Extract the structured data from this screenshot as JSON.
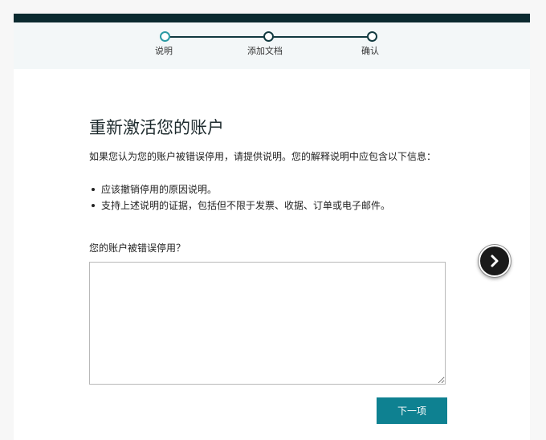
{
  "stepper": {
    "steps": [
      {
        "label": "说明",
        "state": "current"
      },
      {
        "label": "添加文档",
        "state": "pending"
      },
      {
        "label": "确认",
        "state": "pending"
      }
    ]
  },
  "main": {
    "title": "重新激活您的账户",
    "description": "如果您认为您的账户被错误停用，请提供说明。您的解释说明中应包含以下信息：",
    "bullets": [
      "应该撤销停用的原因说明。",
      "支持上述说明的证据，包括但不限于发票、收据、订单或电子邮件。"
    ],
    "field_label": "您的账户被错误停用？",
    "textarea_value": "",
    "next_label": "下一项"
  },
  "overlay": {
    "icon": "chevron-right-icon"
  },
  "colors": {
    "topbar": "#0b2a30",
    "accent": "#0e8191",
    "current_step": "#2a9aa3"
  }
}
